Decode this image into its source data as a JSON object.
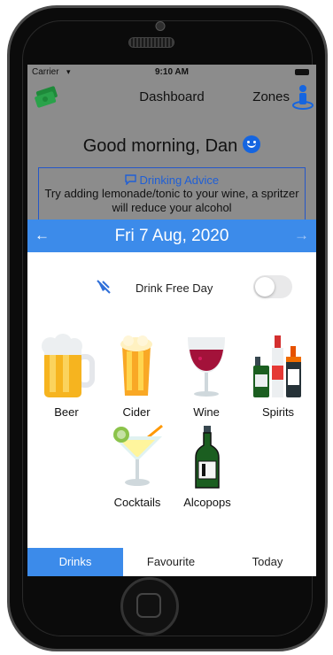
{
  "status": {
    "carrier": "Carrier",
    "time": "9:10 AM"
  },
  "nav": {
    "title": "Dashboard",
    "zones_label": "Zones"
  },
  "greeting": "Good morning, Dan",
  "advice": {
    "heading": "Drinking Advice",
    "text": "Try adding lemonade/tonic to your wine, a spritzer will reduce your alcohol"
  },
  "date_bar": {
    "date": "Fri 7 Aug, 2020",
    "prev": "←",
    "next": "→"
  },
  "drink_free_day": {
    "label": "Drink Free Day",
    "enabled": false
  },
  "drinks": [
    {
      "label": "Beer",
      "icon": "beer-icon"
    },
    {
      "label": "Cider",
      "icon": "cider-icon"
    },
    {
      "label": "Wine",
      "icon": "wine-icon"
    },
    {
      "label": "Spirits",
      "icon": "spirits-icon"
    },
    {
      "label": "Cocktails",
      "icon": "cocktail-icon"
    },
    {
      "label": "Alcopops",
      "icon": "alcopop-icon"
    }
  ],
  "tabs": [
    {
      "label": "Drinks",
      "active": true
    },
    {
      "label": "Favourite",
      "active": false
    },
    {
      "label": "Today",
      "active": false
    }
  ],
  "colors": {
    "accent": "#3c8bea",
    "advice_blue": "#1f5fd6",
    "overlay_gray": "#8c8c8c"
  }
}
